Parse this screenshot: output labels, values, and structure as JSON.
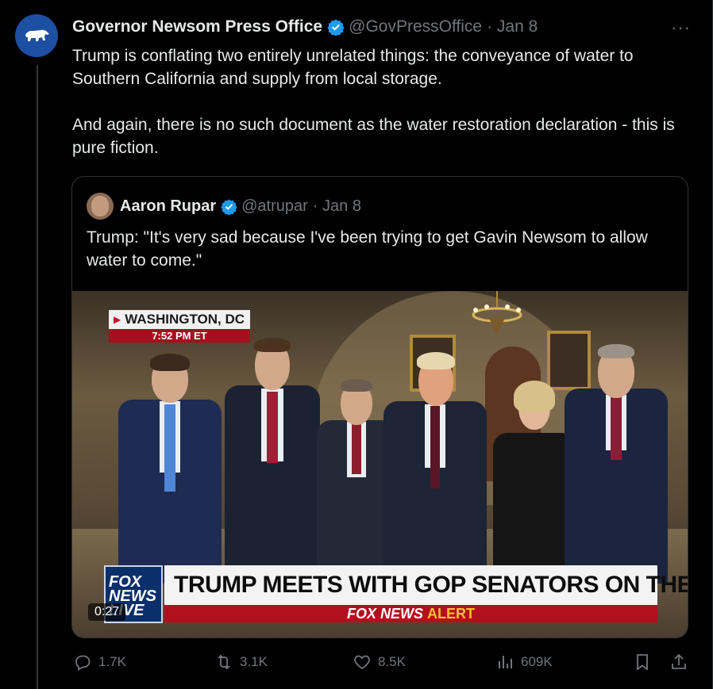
{
  "tweet": {
    "author_name": "Governor Newsom Press Office",
    "handle": "@GovPressOffice",
    "date": "· Jan 8",
    "more_label": "···",
    "text_p1": "Trump is conflating two entirely unrelated things: the conveyance of water to Southern California and supply from local storage.",
    "text_p2": "And again, there is no such document as the water restoration declaration - this is pure fiction."
  },
  "quote": {
    "author_name": "Aaron Rupar",
    "handle": "@atrupar",
    "date": "· Jan 8",
    "text": "Trump: \"It's very sad because I've been trying to get Gavin Newsom to allow water to come.\"",
    "video": {
      "location": "WASHINGTON, DC",
      "time": "7:52 PM ET",
      "headline": "TRUMP MEETS WITH GOP SENATORS ON THE HILL",
      "alert_brand": "FOX NEWS",
      "alert_word": "ALERT",
      "logo_text": "FOX NEWS LIVE",
      "timecode": "0:27"
    }
  },
  "actions": {
    "replies": "1.7K",
    "reposts": "3.1K",
    "likes": "8.5K",
    "views": "609K"
  },
  "colors": {
    "background": "#000000",
    "text": "#e7e9ea",
    "muted": "#71767b",
    "verified": "#1d9bf0",
    "border": "#2f3336"
  }
}
